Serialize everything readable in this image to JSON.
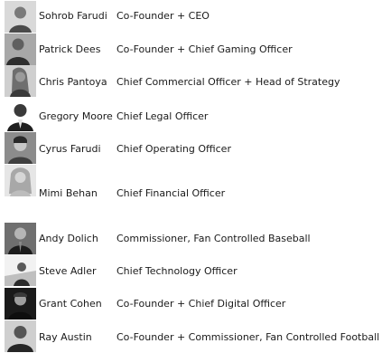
{
  "people": [
    {
      "name": "Sohrob Farudi",
      "title": "Co-Founder + CEO",
      "icon": "person-photo",
      "tone": "#7a7a7a"
    },
    {
      "name": "Patrick Dees",
      "title": "Co-Founder + Chief Gaming Officer",
      "icon": "person-photo",
      "tone": "#5f5f5f"
    },
    {
      "name": "Chris Pantoya",
      "title": "Chief Commercial Officer + Head of Strategy",
      "icon": "person-photo",
      "tone": "#8a8a8a"
    },
    {
      "name": "Gregory Moore",
      "title": "Chief Legal Officer",
      "icon": "person-photo",
      "tone": "#3a3a3a"
    },
    {
      "name": "Cyrus Farudi",
      "title": "Chief Operating Officer",
      "icon": "person-photo",
      "tone": "#6a6a6a"
    },
    {
      "name": "Mimi Behan",
      "title": "Chief Financial Officer",
      "icon": "person-photo",
      "tone": "#b0b0b0"
    },
    {
      "name": "Andy Dolich",
      "title": "Commissioner, Fan Controlled Baseball",
      "icon": "person-photo",
      "tone": "#4a4a4a"
    },
    {
      "name": "Steve Adler",
      "title": "Chief Technology Officer",
      "icon": "person-photo",
      "tone": "#9a9a9a"
    },
    {
      "name": "Grant Cohen",
      "title": "Co-Founder + Chief Digital Officer",
      "icon": "person-photo",
      "tone": "#2e2e2e"
    },
    {
      "name": "Ray Austin",
      "title": "Co-Founder + Commissioner, Fan Controlled Football",
      "icon": "person-photo",
      "tone": "#555555"
    }
  ]
}
